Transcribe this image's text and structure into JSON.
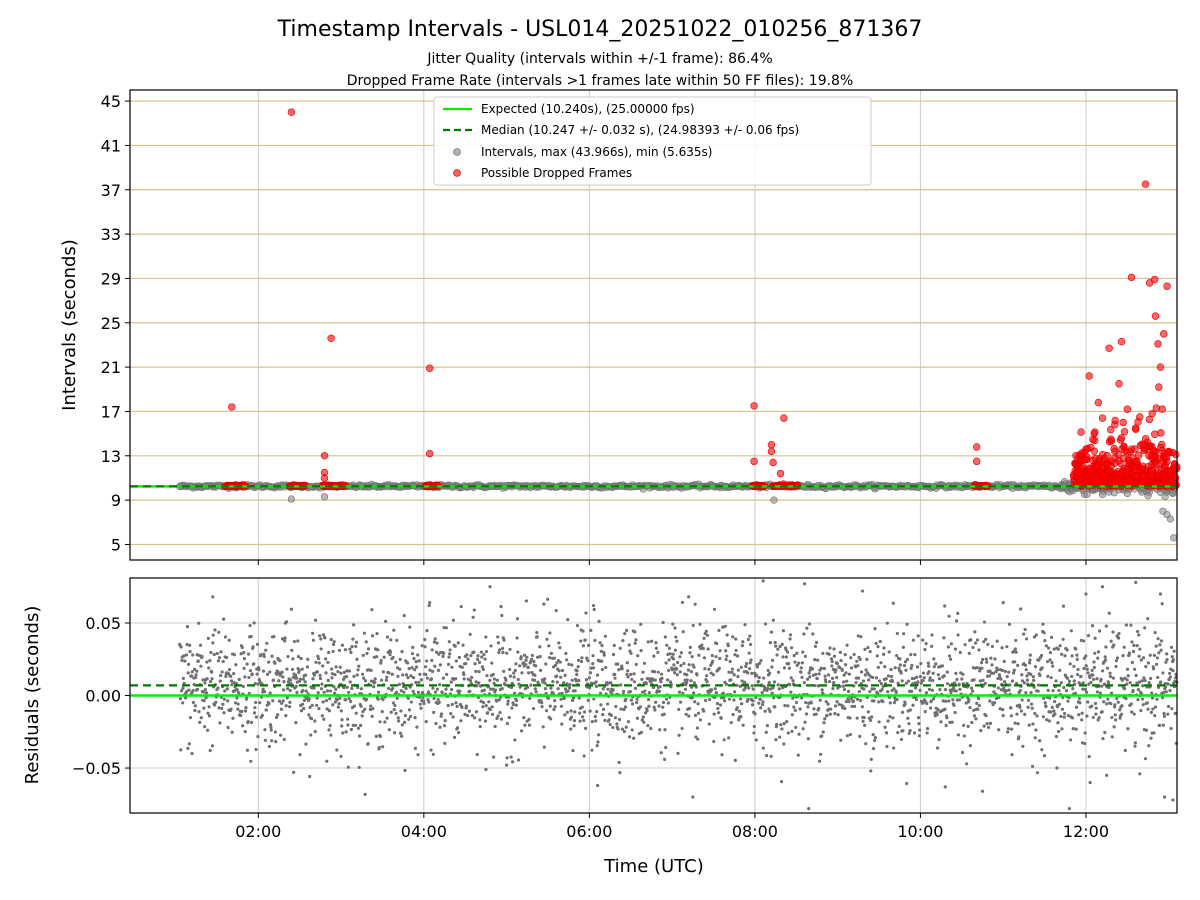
{
  "chart_data": [
    {
      "type": "scatter",
      "title": "Timestamp Intervals - USL014_20251022_010256_871367",
      "subtitle_1": "Jitter Quality (intervals within +/-1 frame): 86.4%",
      "subtitle_2": "Dropped Frame Rate (intervals >1 frames late within 50 FF files): 19.8%",
      "xlabel": "Time (UTC)",
      "ylabel": "Intervals (seconds)",
      "x_ticks": [
        "02:00",
        "04:00",
        "06:00",
        "08:00",
        "10:00",
        "12:00"
      ],
      "x_tick_hours": [
        2,
        4,
        6,
        8,
        10,
        12
      ],
      "xlim_hours": [
        0.45,
        13.1
      ],
      "ylim": [
        3.6,
        46
      ],
      "y_ticks": [
        5,
        9,
        13,
        17,
        21,
        25,
        29,
        33,
        37,
        41,
        45
      ],
      "grid": "vertical gray, horizontal gold",
      "legend_position": "top-center",
      "legend": [
        "Expected (10.240s), (25.00000 fps)",
        "Median (10.247 +/- 0.032 s), (24.98393 +/- 0.06 fps)",
        "Intervals, max (43.966s), min (5.635s)",
        "Possible Dropped Frames"
      ],
      "expected_interval": 10.24,
      "median_interval": 10.247,
      "colors": {
        "expected": "#00ee00",
        "median": "#007700",
        "intervals": "#808080",
        "dropped": "#ff0000"
      },
      "dropped_points": [
        [
          1.68,
          17.4
        ],
        [
          2.4,
          44.0
        ],
        [
          2.8,
          13.0
        ],
        [
          2.8,
          11.5
        ],
        [
          2.8,
          11.0
        ],
        [
          2.88,
          23.6
        ],
        [
          4.07,
          20.9
        ],
        [
          4.07,
          13.2
        ],
        [
          7.99,
          17.5
        ],
        [
          7.99,
          12.5
        ],
        [
          8.2,
          14.0
        ],
        [
          8.2,
          13.4
        ],
        [
          8.22,
          12.4
        ],
        [
          8.31,
          11.4
        ],
        [
          8.35,
          16.4
        ],
        [
          10.68,
          13.8
        ],
        [
          10.68,
          12.5
        ],
        [
          11.88,
          13.0
        ],
        [
          12.04,
          20.2
        ],
        [
          12.15,
          17.8
        ],
        [
          12.28,
          22.7
        ],
        [
          12.43,
          23.3
        ],
        [
          12.4,
          19.5
        ],
        [
          12.2,
          16.4
        ],
        [
          12.5,
          17.2
        ],
        [
          12.55,
          29.1
        ],
        [
          12.72,
          37.5
        ],
        [
          12.77,
          28.6
        ],
        [
          12.83,
          28.9
        ],
        [
          12.87,
          23.1
        ],
        [
          12.94,
          24.0
        ],
        [
          12.98,
          28.3
        ],
        [
          12.84,
          25.6
        ],
        [
          12.88,
          19.2
        ],
        [
          12.9,
          21.0
        ],
        [
          12.85,
          17.3
        ],
        [
          12.6,
          15.5
        ],
        [
          12.3,
          14.5
        ],
        [
          12.7,
          14.0
        ],
        [
          12.95,
          13.2
        ],
        [
          12.1,
          15.0
        ],
        [
          12.45,
          16.0
        ],
        [
          12.65,
          16.5
        ],
        [
          12.8,
          16.8
        ],
        [
          12.35,
          12.8
        ],
        [
          12.55,
          13.6
        ],
        [
          12.25,
          12.3
        ],
        [
          12.9,
          12.8
        ],
        [
          12.0,
          13.6
        ],
        [
          12.05,
          11.8
        ]
      ],
      "dropped_clusters_x": [
        [
          1.6,
          1.85
        ],
        [
          2.38,
          2.57
        ],
        [
          2.78,
          3.05
        ],
        [
          4.02,
          4.18
        ],
        [
          7.97,
          8.12
        ],
        [
          8.22,
          8.52
        ],
        [
          10.65,
          10.82
        ],
        [
          11.85,
          13.1
        ]
      ],
      "gray_low_points": [
        [
          2.4,
          9.1
        ],
        [
          2.8,
          9.3
        ],
        [
          8.23,
          9.0
        ],
        [
          12.93,
          8.0
        ],
        [
          12.98,
          7.7
        ],
        [
          13.02,
          7.3
        ],
        [
          13.06,
          5.6
        ],
        [
          12.5,
          9.6
        ],
        [
          12.2,
          9.5
        ],
        [
          12.75,
          9.4
        ],
        [
          13.05,
          9.6
        ]
      ]
    },
    {
      "type": "scatter",
      "xlabel": "Time (UTC)",
      "ylabel": "Residuals (seconds)",
      "x_ticks": [
        "02:00",
        "04:00",
        "06:00",
        "08:00",
        "10:00",
        "12:00"
      ],
      "x_tick_hours": [
        2,
        4,
        6,
        8,
        10,
        12
      ],
      "xlim_hours": [
        0.45,
        13.1
      ],
      "ylim": [
        -0.081,
        0.081
      ],
      "y_ticks": [
        "0.05",
        "0.00",
        "−0.05"
      ],
      "y_tick_values": [
        0.05,
        0.0,
        -0.05
      ],
      "grid": "gray",
      "expected_residual": 0.0,
      "median_residual": 0.007,
      "residual_range_hours": [
        1.05,
        13.1
      ],
      "residual_spread": 0.02,
      "residual_outliers": [
        [
          1.45,
          0.068
        ],
        [
          4.07,
          0.064
        ],
        [
          4.8,
          0.075
        ],
        [
          5.45,
          0.063
        ],
        [
          6.05,
          0.062
        ],
        [
          7.2,
          0.068
        ],
        [
          8.1,
          0.079
        ],
        [
          8.6,
          0.077
        ],
        [
          9.3,
          0.072
        ],
        [
          11.0,
          0.064
        ],
        [
          12.0,
          0.07
        ],
        [
          12.2,
          0.075
        ],
        [
          12.9,
          0.07
        ],
        [
          6.1,
          -0.062
        ],
        [
          7.25,
          -0.07
        ],
        [
          8.65,
          -0.078
        ],
        [
          10.3,
          -0.063
        ],
        [
          10.75,
          -0.066
        ],
        [
          11.8,
          -0.078
        ],
        [
          12.05,
          -0.06
        ],
        [
          12.25,
          -0.055
        ],
        [
          12.65,
          -0.054
        ],
        [
          12.95,
          -0.07
        ],
        [
          13.05,
          -0.072
        ],
        [
          4.75,
          -0.051
        ],
        [
          5.0,
          -0.048
        ],
        [
          9.4,
          -0.052
        ],
        [
          11.65,
          -0.05
        ],
        [
          1.2,
          -0.04
        ],
        [
          3.0,
          -0.042
        ]
      ]
    }
  ]
}
